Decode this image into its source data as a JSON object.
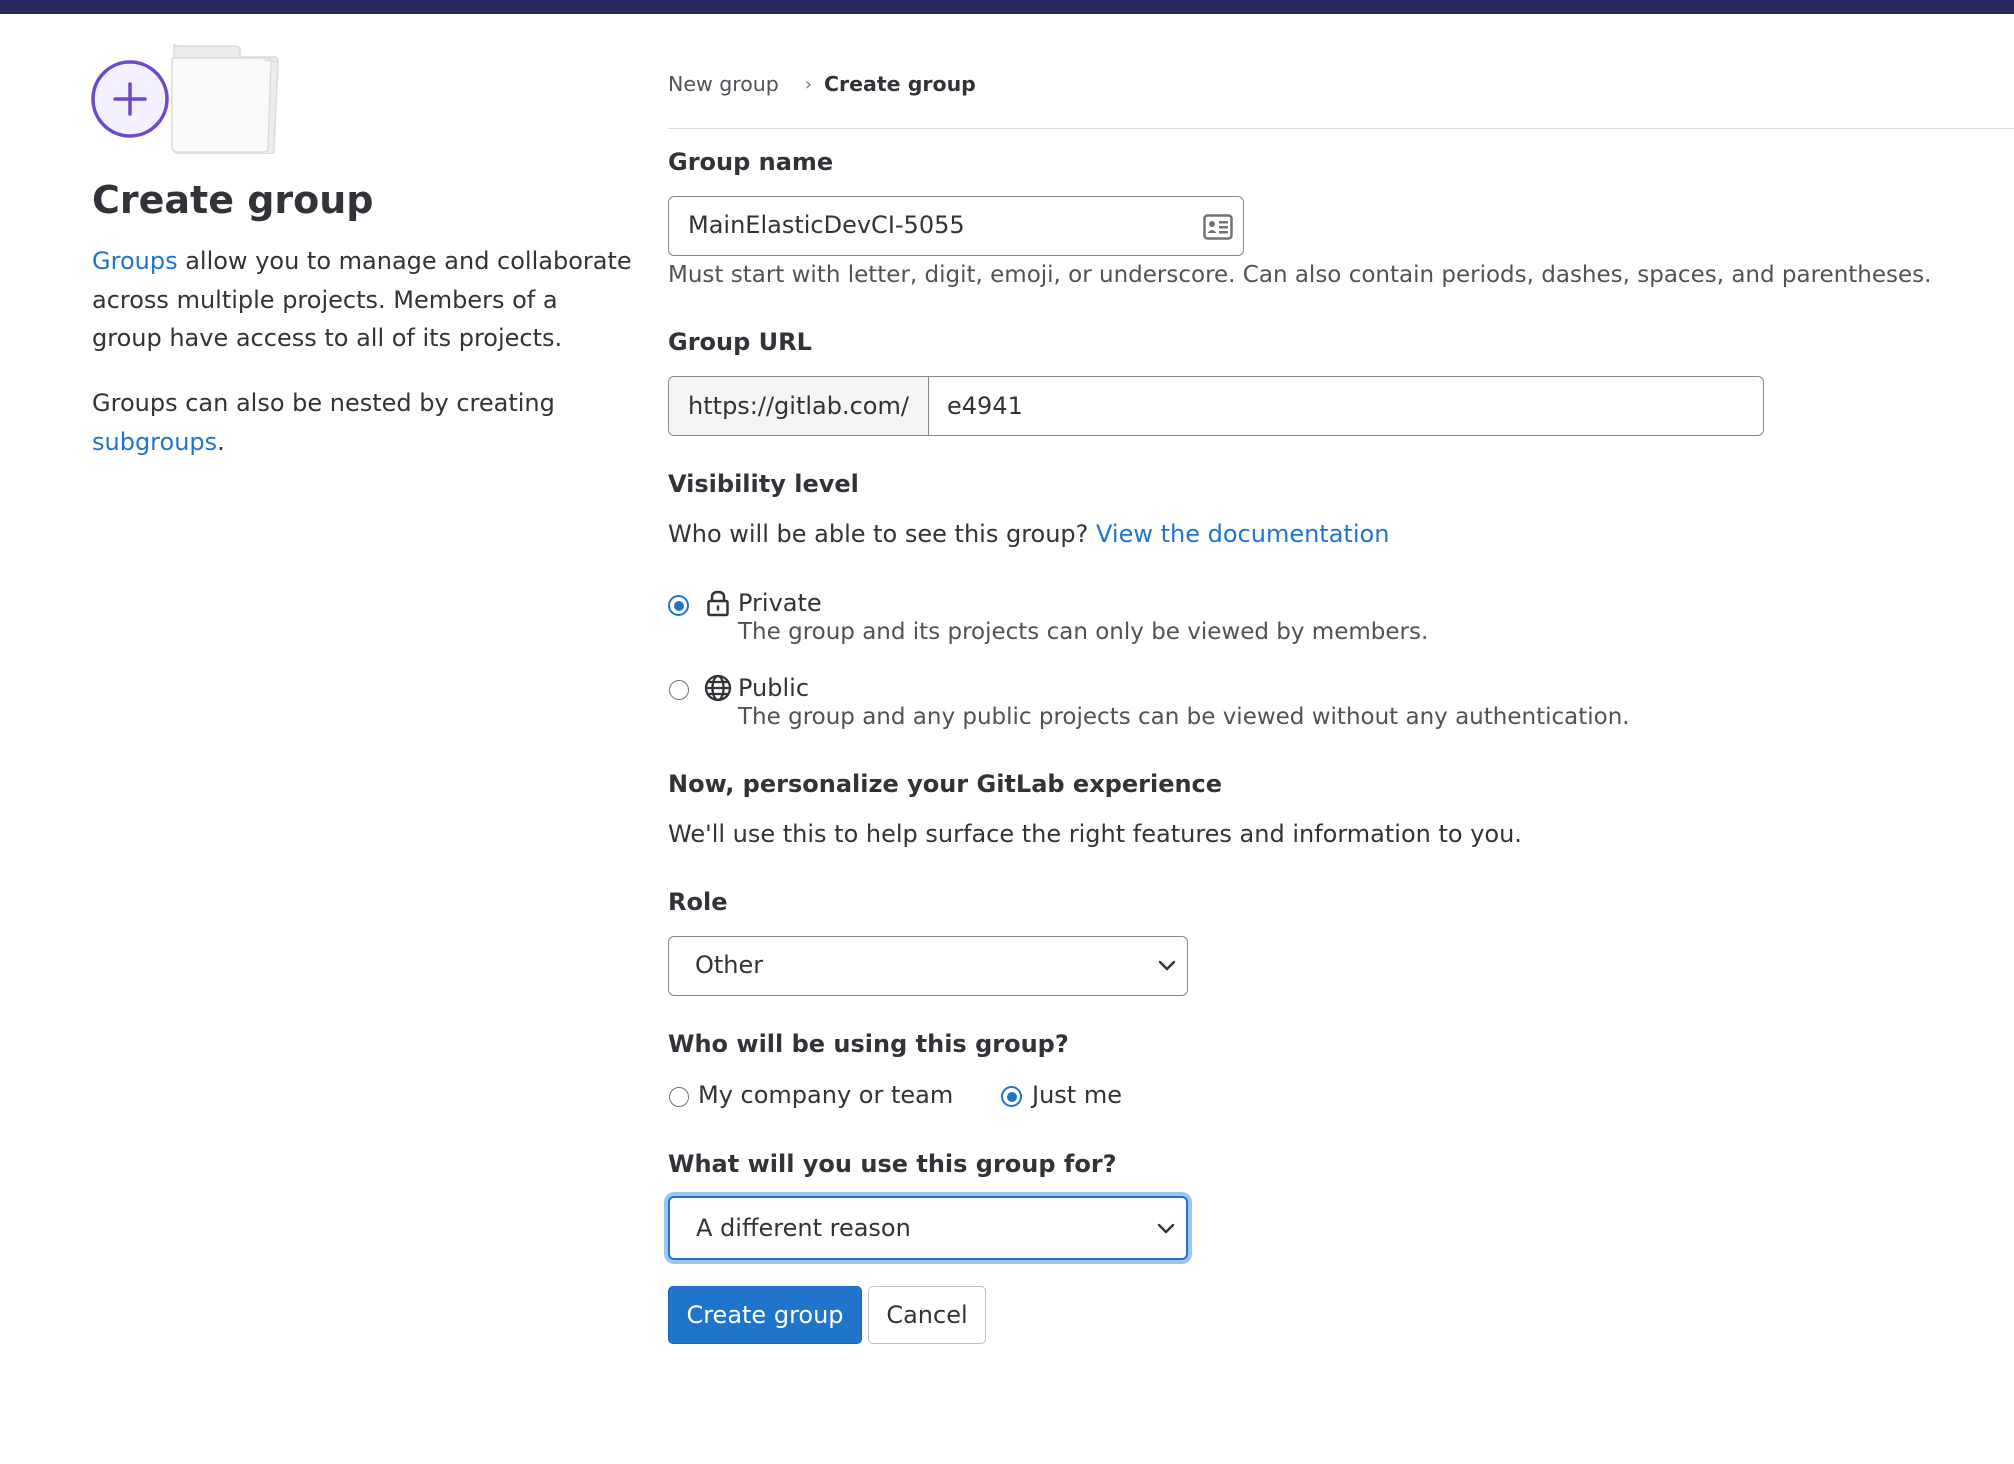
{
  "brand": {
    "topbar_color": "#292961",
    "accent": "#1f75cb",
    "illustration_color": "#6e49cb"
  },
  "sidebar": {
    "title": "Create group",
    "intro_link": "Groups",
    "intro_text": " allow you to manage and collaborate across multiple projects. Members of a group have access to all of its projects.",
    "nested_text": "Groups can also be nested by creating ",
    "nested_link": "subgroups",
    "nested_end": "."
  },
  "breadcrumb": {
    "items": [
      "New group",
      "Create group"
    ],
    "separator": "›"
  },
  "form": {
    "group_name": {
      "label": "Group name",
      "value": "MainElasticDevCI-5055",
      "icon": "contact-card-icon",
      "help": "Must start with letter, digit, emoji, or underscore. Can also contain periods, dashes, spaces, and parentheses."
    },
    "group_url": {
      "label": "Group URL",
      "prefix": "https://gitlab.com/",
      "value": "e4941"
    },
    "visibility": {
      "label": "Visibility level",
      "question": "Who will be able to see this group? ",
      "doc_link": "View the documentation",
      "selected": "private",
      "options": [
        {
          "title": "Private",
          "icon": "lock-icon",
          "desc": "The group and its projects can only be viewed by members."
        },
        {
          "title": "Public",
          "icon": "globe-icon",
          "desc": "The group and any public projects can be viewed without any authentication."
        }
      ]
    },
    "personalize": {
      "title": "Now, personalize your GitLab experience",
      "text": "We'll use this to help surface the right features and information to you."
    },
    "role": {
      "label": "Role",
      "value": "Other"
    },
    "who": {
      "label": "Who will be using this group?",
      "selected": "just_me",
      "options": [
        "My company or team",
        "Just me"
      ]
    },
    "purpose": {
      "label": "What will you use this group for?",
      "value": "A different reason"
    },
    "buttons": {
      "submit": "Create group",
      "cancel": "Cancel"
    }
  }
}
